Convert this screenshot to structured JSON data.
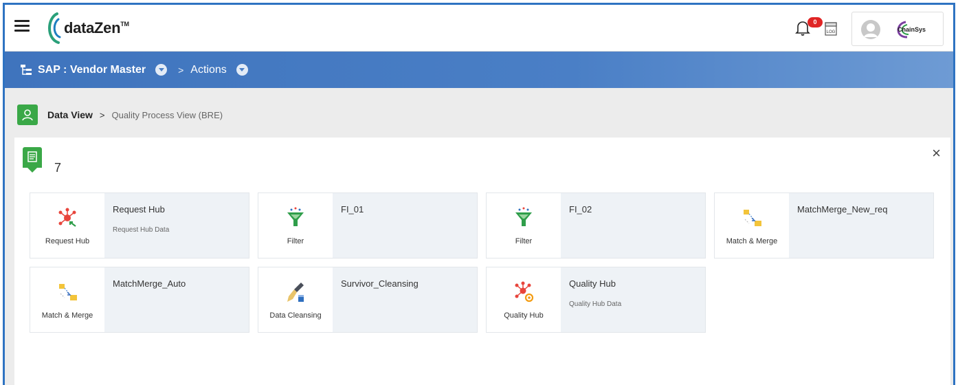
{
  "header": {
    "logo_text": "dataZen",
    "logo_tm": "TM",
    "notification_count": "0",
    "log_label": "LOG",
    "company_logo_text": "ChainSys"
  },
  "nav": {
    "title": "SAP : Vendor Master",
    "separator": ">",
    "actions_label": "Actions"
  },
  "breadcrumb": {
    "main": "Data View",
    "separator": ">",
    "sub": "Quality Process View (BRE)"
  },
  "panel": {
    "count": "7",
    "close": "×"
  },
  "cards": [
    {
      "type": "Request Hub",
      "name": "Request Hub",
      "desc": "Request Hub Data",
      "icon": "request-hub-icon"
    },
    {
      "type": "Filter",
      "name": "FI_01",
      "desc": "",
      "icon": "filter-icon"
    },
    {
      "type": "Filter",
      "name": "FI_02",
      "desc": "",
      "icon": "filter-icon"
    },
    {
      "type": "Match & Merge",
      "name": "MatchMerge_New_req",
      "desc": "",
      "icon": "match-merge-icon"
    },
    {
      "type": "Match & Merge",
      "name": "MatchMerge_Auto",
      "desc": "",
      "icon": "match-merge-icon"
    },
    {
      "type": "Data Cleansing",
      "name": "Survivor_Cleansing",
      "desc": "",
      "icon": "data-cleansing-icon"
    },
    {
      "type": "Quality Hub",
      "name": "Quality Hub",
      "desc": "Quality Hub Data",
      "icon": "quality-hub-icon"
    }
  ],
  "colors": {
    "accent_blue": "#4a7fc6",
    "frame_blue": "#2e73c2",
    "green": "#3aa847",
    "badge_red": "#e02424"
  }
}
